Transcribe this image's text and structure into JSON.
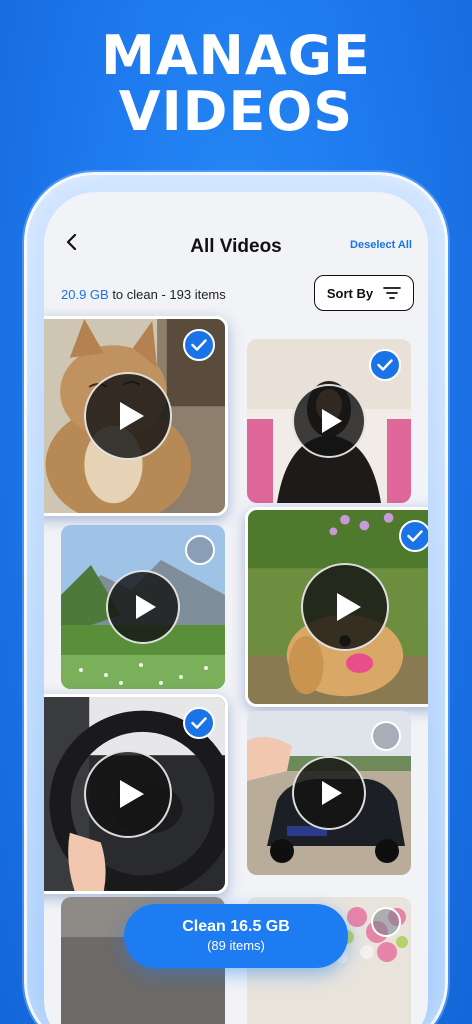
{
  "promo": {
    "line1": "MANAGE",
    "line2": "VIDEOS"
  },
  "header": {
    "title": "All Videos",
    "deselect_label": "Deselect All"
  },
  "summary": {
    "size": "20.9 GB",
    "rest": " to clean - 193 items"
  },
  "sort": {
    "label": "Sort By"
  },
  "videos": [
    {
      "subject": "cat",
      "selected": true
    },
    {
      "subject": "woman",
      "selected": true
    },
    {
      "subject": "mountain meadow",
      "selected": false
    },
    {
      "subject": "dog",
      "selected": true
    },
    {
      "subject": "steering wheel",
      "selected": true
    },
    {
      "subject": "car",
      "selected": false
    },
    {
      "subject": "partial",
      "selected": false
    },
    {
      "subject": "flowers",
      "selected": false
    }
  ],
  "clean_button": {
    "line1": "Clean 16.5 GB",
    "line2": "(89 items)"
  },
  "colors": {
    "accent": "#1a74e8",
    "background": "#1f7cf0"
  }
}
